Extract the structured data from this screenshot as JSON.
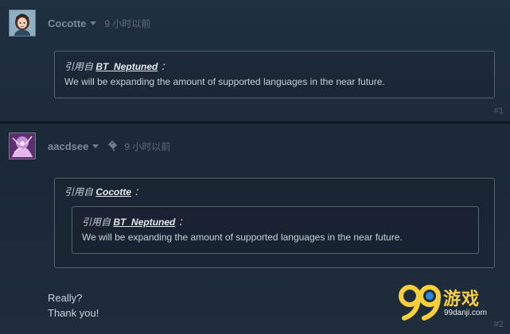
{
  "posts": [
    {
      "author": "Cocotte",
      "timestamp": "9 小时以前",
      "quote": {
        "prefix": "引用自",
        "author": "BT_Neptuned",
        "suffix": "：",
        "body": "We will be expanding the amount of supported languages in the near future."
      },
      "number": "#1"
    },
    {
      "author": "aacdsee",
      "timestamp": "9 小时以前",
      "quote": {
        "prefix": "引用自",
        "author": "Cocotte",
        "suffix": "：",
        "nested": {
          "prefix": "引用自",
          "author": "BT_Neptuned",
          "suffix": "：",
          "body": "We will be expanding the amount of supported languages in the near future."
        }
      },
      "reply": [
        "Really?",
        "Thank you!"
      ],
      "number": "#2"
    }
  ],
  "watermark": {
    "logo_text": "游戏",
    "url": "99danji.com"
  },
  "colors": {
    "background": "#1f2a38",
    "quote_border": "#56626e",
    "text": "#c6d0d9",
    "watermark_yellow": "#f7cf3b"
  },
  "icons": [
    "caret-down-icon",
    "edit-tag-icon"
  ]
}
